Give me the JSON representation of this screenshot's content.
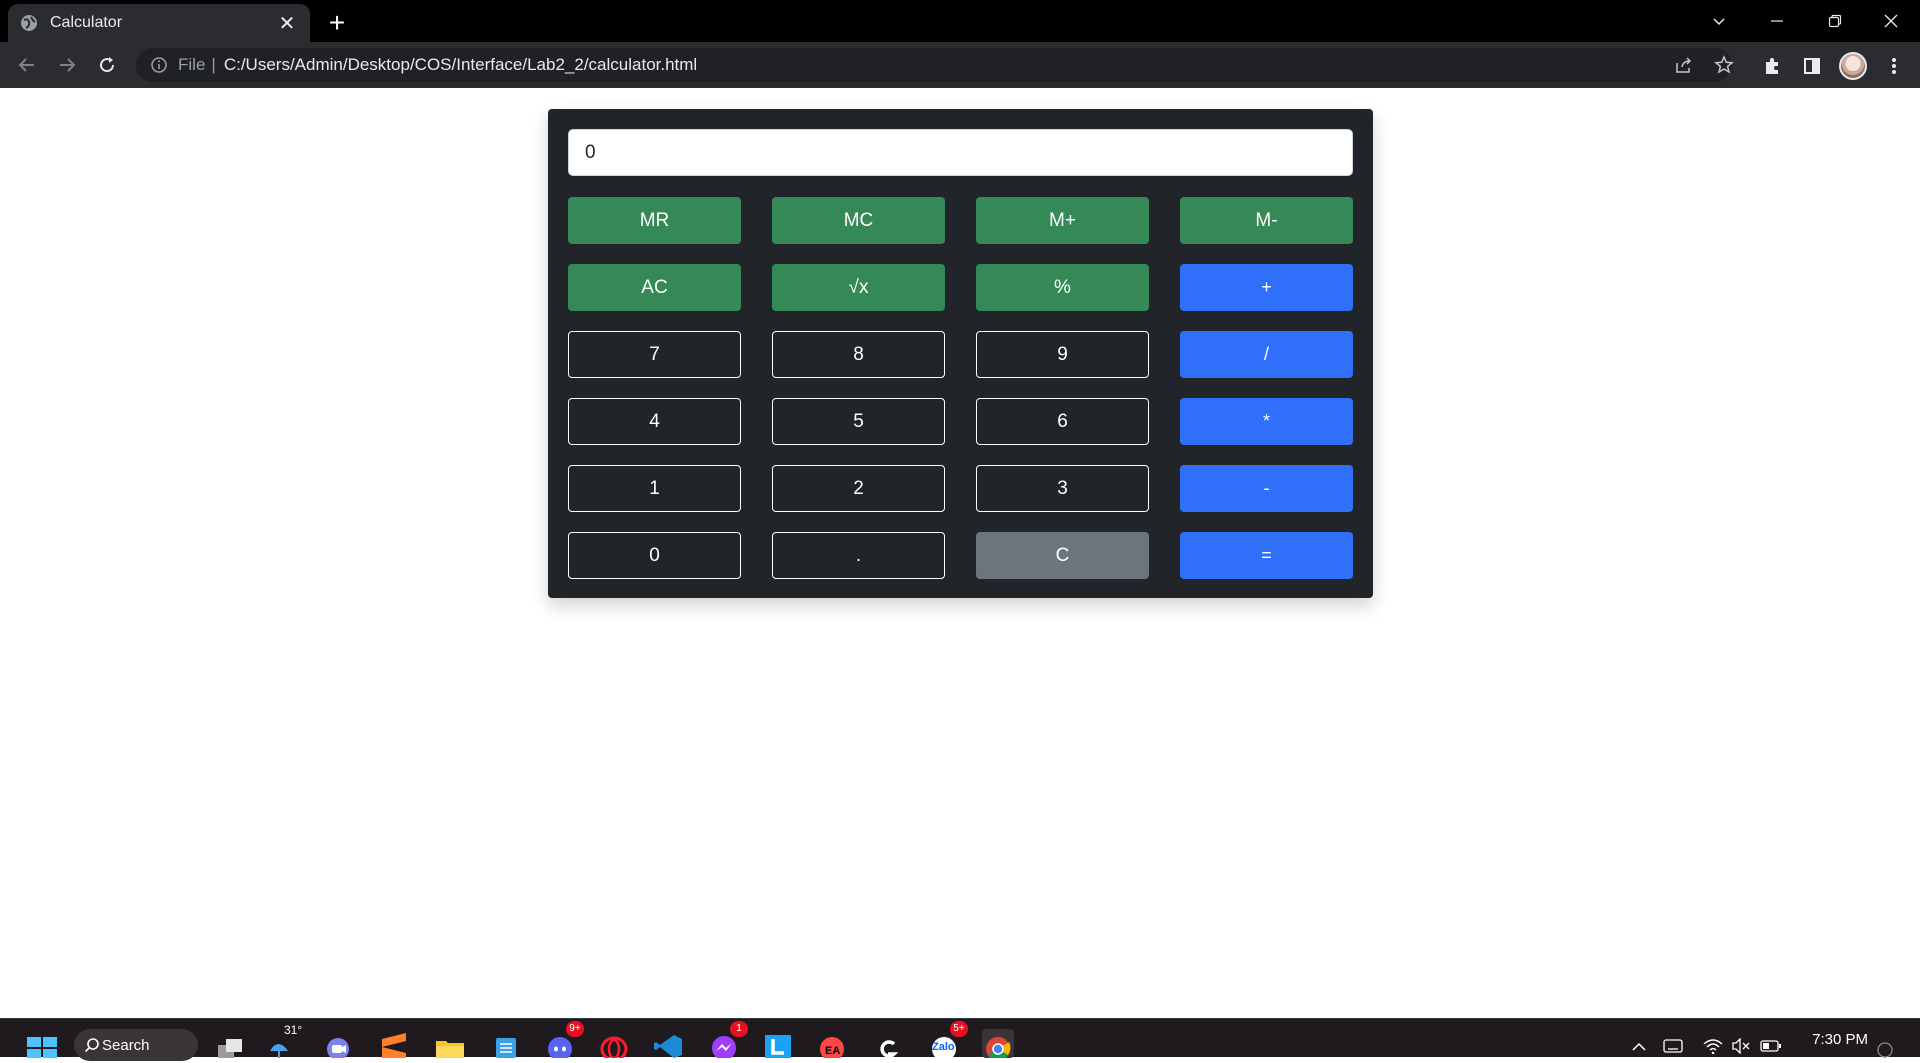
{
  "browser": {
    "tab_title": "Calculator",
    "tab_close": "✕",
    "new_tab": "+",
    "omnibox_scheme": "File",
    "omnibox_url": "C:/Users/Admin/Desktop/COS/Interface/Lab2_2/calculator.html"
  },
  "calculator": {
    "display_value": "0",
    "rows": [
      [
        {
          "label": "MR",
          "style": "green"
        },
        {
          "label": "MC",
          "style": "green"
        },
        {
          "label": "M+",
          "style": "green"
        },
        {
          "label": "M-",
          "style": "green"
        }
      ],
      [
        {
          "label": "AC",
          "style": "green"
        },
        {
          "label": "√x",
          "style": "green"
        },
        {
          "label": "%",
          "style": "green"
        },
        {
          "label": "+",
          "style": "blue"
        }
      ],
      [
        {
          "label": "7",
          "style": "outline"
        },
        {
          "label": "8",
          "style": "outline"
        },
        {
          "label": "9",
          "style": "outline"
        },
        {
          "label": "/",
          "style": "blue"
        }
      ],
      [
        {
          "label": "4",
          "style": "outline"
        },
        {
          "label": "5",
          "style": "outline"
        },
        {
          "label": "6",
          "style": "outline"
        },
        {
          "label": "*",
          "style": "blue"
        }
      ],
      [
        {
          "label": "1",
          "style": "outline"
        },
        {
          "label": "2",
          "style": "outline"
        },
        {
          "label": "3",
          "style": "outline"
        },
        {
          "label": "-",
          "style": "blue"
        }
      ],
      [
        {
          "label": "0",
          "style": "outline"
        },
        {
          "label": ".",
          "style": "outline"
        },
        {
          "label": "C",
          "style": "gray"
        },
        {
          "label": "=",
          "style": "blue"
        }
      ]
    ]
  },
  "taskbar": {
    "search_label": "Search",
    "weather_temp": "31°",
    "discord_badge": "9+",
    "messenger_badge": "1",
    "zalo_badge": "5+",
    "zalo_label": "Zalo",
    "clock_time": "7:30 PM"
  },
  "colors": {
    "panel": "#212529",
    "green": "#358957",
    "blue": "#2f6ff9",
    "gray": "#6c757d"
  }
}
